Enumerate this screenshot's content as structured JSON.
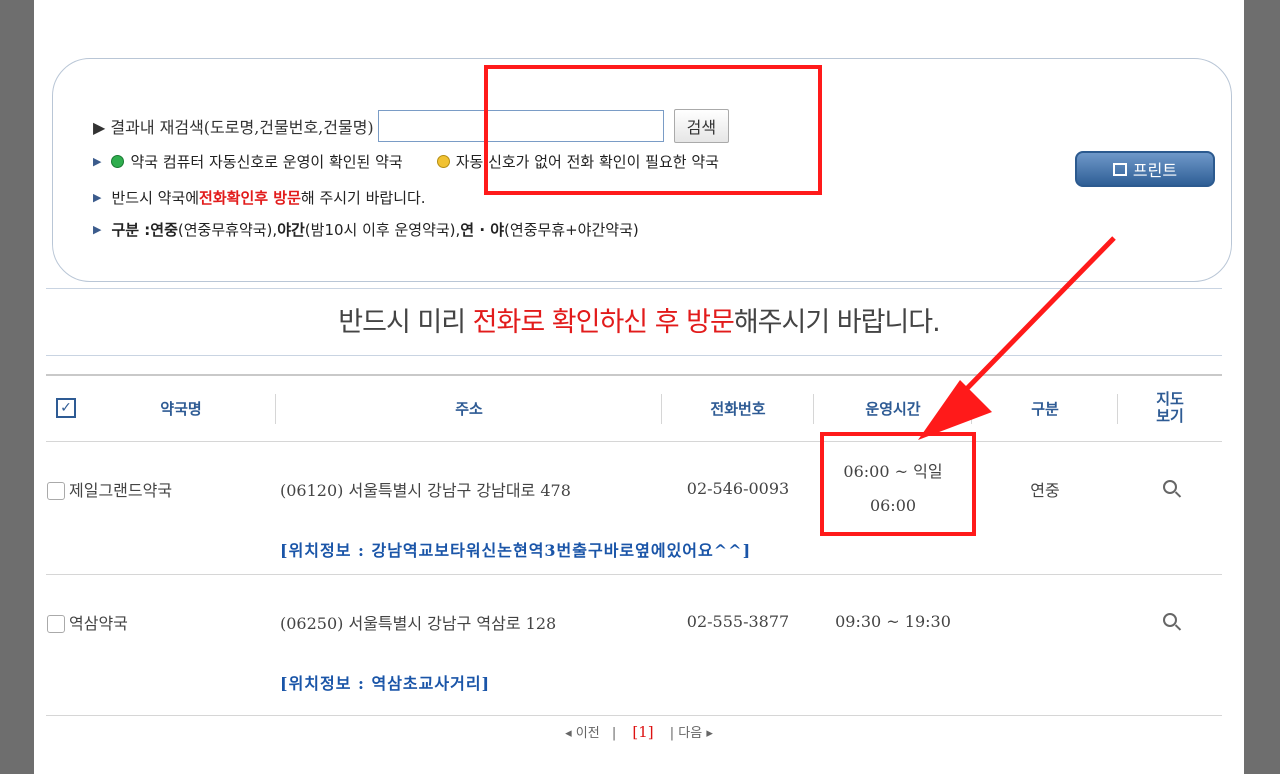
{
  "search": {
    "label": "▶ 결과내 재검색(도로명,건물번호,건물명)",
    "value": "",
    "button": "검색"
  },
  "notes": {
    "legend_green": "약국 컴퓨터 자동신호로 운영이 확인된 약국",
    "legend_yellow": "자동 신호가 없어 전화 확인이 필요한 약국",
    "must_prefix": "반드시 약국에 ",
    "must_highlight": "전화확인후 방문",
    "must_suffix": "해 주시기 바랍니다.",
    "cat_label": "구분 : ",
    "cat_yeonjung": "연중",
    "cat_yeonjung_desc": "(연중무휴약국), ",
    "cat_yagan": "야간",
    "cat_yagan_desc": "(밤10시 이후 운영약국), ",
    "cat_both": "연 · 야",
    "cat_both_desc": "(연중무휴+야간약국)"
  },
  "print_button": "프린트",
  "notice": {
    "prefix": "반드시 미리 ",
    "highlight": "전화로 확인하신 후 방문",
    "suffix": "해주시기 바랍니다."
  },
  "table": {
    "headers": {
      "check": "✓",
      "name": "약국명",
      "address": "주소",
      "phone": "전화번호",
      "hours": "운영시간",
      "category": "구분",
      "map_line1": "지도",
      "map_line2": "보기"
    },
    "rows": [
      {
        "name": "제일그랜드약국",
        "address": "(06120) 서울특별시 강남구 강남대로 478",
        "phone": "02-546-0093",
        "hours_line1": "06:00 ~ 익일",
        "hours_line2": "06:00",
        "category": "연중",
        "location": "[위치정보 : 강남역교보타워신논현역3번출구바로옆에있어요^^]"
      },
      {
        "name": "역삼약국",
        "address": "(06250) 서울특별시 강남구 역삼로 128",
        "phone": "02-555-3877",
        "hours_line1": "09:30 ~ 19:30",
        "hours_line2": "",
        "category": "",
        "location": "[위치정보 : 역삼초교사거리]"
      }
    ]
  },
  "pager": {
    "prev": "◂ 이전",
    "current": "[1]",
    "next": "다음 ▸"
  },
  "colors": {
    "accent_blue": "#2e5b94",
    "highlight_red": "#e21b1b",
    "annotation_red": "#ff1a1a"
  }
}
